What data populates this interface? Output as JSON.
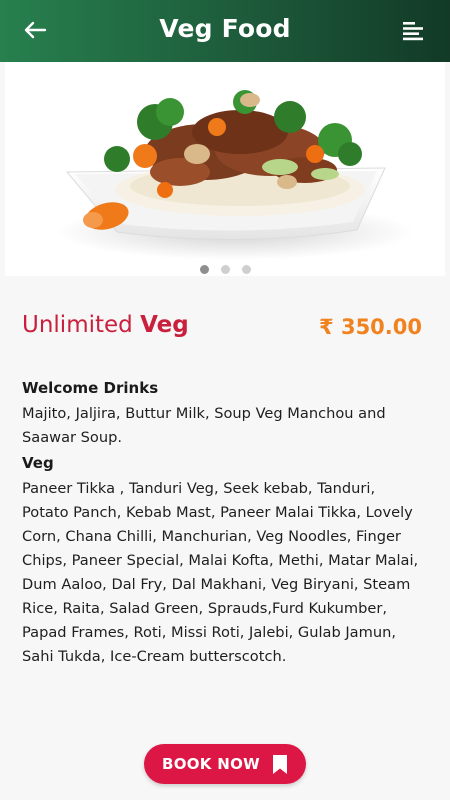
{
  "header": {
    "title": "Veg Food",
    "back_icon": "arrow-left-icon",
    "menu_icon": "menu-lines-icon"
  },
  "carousel": {
    "image_alt": "veg-food-plate",
    "dot_count": 3,
    "active_index": 0
  },
  "dish": {
    "name_prefix": "Unlimited ",
    "name_emphasis": "Veg",
    "price": "₹ 350.00"
  },
  "sections": [
    {
      "title": "Welcome Drinks",
      "text": "Majito, Jaljira, Buttur Milk, Soup Veg Manchou and Saawar Soup."
    },
    {
      "title": "Veg",
      "text": "Paneer Tikka , Tanduri Veg, Seek kebab, Tanduri, Potato Panch, Kebab Mast, Paneer Malai Tikka, Lovely Corn, Chana Chilli, Manchurian, Veg Noodles, Finger Chips, Paneer Special, Malai Kofta, Methi, Matar Malai, Dum Aaloo, Dal Fry, Dal Makhani, Veg Biryani, Steam Rice, Raita, Salad Green, Sprauds,Furd Kukumber, Papad Frames, Roti, Missi Roti, Jalebi, Gulab Jamun, Sahi Tukda, Ice-Cream butterscotch."
    }
  ],
  "cta": {
    "label": "BOOK NOW",
    "icon": "bookmark-icon"
  },
  "colors": {
    "header_start": "#27804e",
    "header_end": "#123a27",
    "accent_red": "#c8203d",
    "price_orange": "#f0821f",
    "button_red": "#dc1745"
  }
}
